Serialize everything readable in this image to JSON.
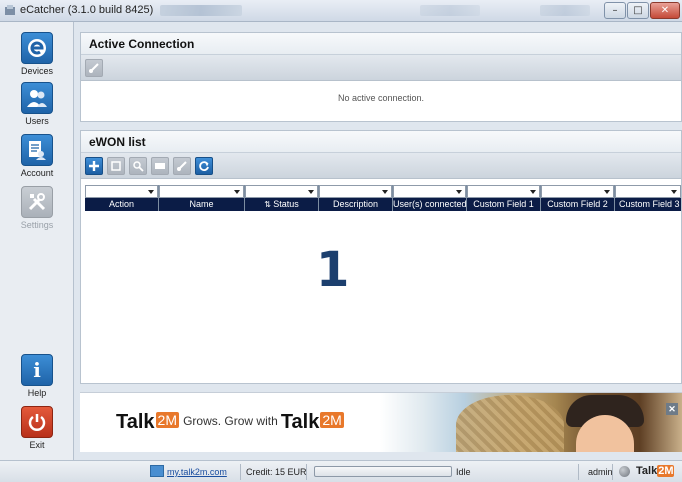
{
  "window": {
    "title": "eCatcher",
    "build": "(3.1.0 build 8425)"
  },
  "sidebar": {
    "items": [
      {
        "label": "Devices",
        "icon": "ecatcher-logo-icon",
        "enabled": true
      },
      {
        "label": "Users",
        "icon": "users-icon",
        "enabled": true
      },
      {
        "label": "Account",
        "icon": "account-icon",
        "enabled": true
      },
      {
        "label": "Settings",
        "icon": "settings-icon",
        "enabled": false
      },
      {
        "label": "Help",
        "icon": "info-icon",
        "enabled": true
      },
      {
        "label": "Exit",
        "icon": "power-icon",
        "enabled": true
      }
    ]
  },
  "active_connection": {
    "title": "Active Connection",
    "empty_message": "No active connection."
  },
  "ewon_list": {
    "title": "eWON list",
    "columns": [
      "Action",
      "Name",
      "Status",
      "Description",
      "User(s) connected",
      "Custom Field 1",
      "Custom Field 2",
      "Custom Field 3"
    ]
  },
  "overlay_number": "1",
  "banner": {
    "brand_prefix": "Talk",
    "brand_m": "2M",
    "tagline": "Grows. Grow with",
    "brand_prefix_2": "Talk",
    "brand_m_2": "2M"
  },
  "statusbar": {
    "link": "my.talk2m.com",
    "credit": "Credit: 15 EUR",
    "progress": 0,
    "state": "Idle",
    "user": "admin",
    "brand_prefix": "Talk",
    "brand_m": "2M"
  },
  "colors": {
    "accent": "#1f63a8",
    "grid_header": "#0b1c46",
    "brand_orange": "#e8782b",
    "exit_red": "#c43a22"
  }
}
